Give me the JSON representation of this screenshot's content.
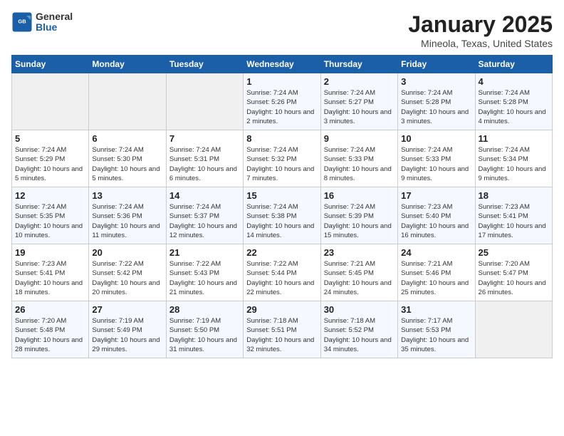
{
  "logo": {
    "general": "General",
    "blue": "Blue"
  },
  "title": "January 2025",
  "subtitle": "Mineola, Texas, United States",
  "weekdays": [
    "Sunday",
    "Monday",
    "Tuesday",
    "Wednesday",
    "Thursday",
    "Friday",
    "Saturday"
  ],
  "weeks": [
    [
      {
        "day": "",
        "sunrise": "",
        "sunset": "",
        "daylight": ""
      },
      {
        "day": "",
        "sunrise": "",
        "sunset": "",
        "daylight": ""
      },
      {
        "day": "",
        "sunrise": "",
        "sunset": "",
        "daylight": ""
      },
      {
        "day": "1",
        "sunrise": "Sunrise: 7:24 AM",
        "sunset": "Sunset: 5:26 PM",
        "daylight": "Daylight: 10 hours and 2 minutes."
      },
      {
        "day": "2",
        "sunrise": "Sunrise: 7:24 AM",
        "sunset": "Sunset: 5:27 PM",
        "daylight": "Daylight: 10 hours and 3 minutes."
      },
      {
        "day": "3",
        "sunrise": "Sunrise: 7:24 AM",
        "sunset": "Sunset: 5:28 PM",
        "daylight": "Daylight: 10 hours and 3 minutes."
      },
      {
        "day": "4",
        "sunrise": "Sunrise: 7:24 AM",
        "sunset": "Sunset: 5:28 PM",
        "daylight": "Daylight: 10 hours and 4 minutes."
      }
    ],
    [
      {
        "day": "5",
        "sunrise": "Sunrise: 7:24 AM",
        "sunset": "Sunset: 5:29 PM",
        "daylight": "Daylight: 10 hours and 5 minutes."
      },
      {
        "day": "6",
        "sunrise": "Sunrise: 7:24 AM",
        "sunset": "Sunset: 5:30 PM",
        "daylight": "Daylight: 10 hours and 5 minutes."
      },
      {
        "day": "7",
        "sunrise": "Sunrise: 7:24 AM",
        "sunset": "Sunset: 5:31 PM",
        "daylight": "Daylight: 10 hours and 6 minutes."
      },
      {
        "day": "8",
        "sunrise": "Sunrise: 7:24 AM",
        "sunset": "Sunset: 5:32 PM",
        "daylight": "Daylight: 10 hours and 7 minutes."
      },
      {
        "day": "9",
        "sunrise": "Sunrise: 7:24 AM",
        "sunset": "Sunset: 5:33 PM",
        "daylight": "Daylight: 10 hours and 8 minutes."
      },
      {
        "day": "10",
        "sunrise": "Sunrise: 7:24 AM",
        "sunset": "Sunset: 5:33 PM",
        "daylight": "Daylight: 10 hours and 9 minutes."
      },
      {
        "day": "11",
        "sunrise": "Sunrise: 7:24 AM",
        "sunset": "Sunset: 5:34 PM",
        "daylight": "Daylight: 10 hours and 9 minutes."
      }
    ],
    [
      {
        "day": "12",
        "sunrise": "Sunrise: 7:24 AM",
        "sunset": "Sunset: 5:35 PM",
        "daylight": "Daylight: 10 hours and 10 minutes."
      },
      {
        "day": "13",
        "sunrise": "Sunrise: 7:24 AM",
        "sunset": "Sunset: 5:36 PM",
        "daylight": "Daylight: 10 hours and 11 minutes."
      },
      {
        "day": "14",
        "sunrise": "Sunrise: 7:24 AM",
        "sunset": "Sunset: 5:37 PM",
        "daylight": "Daylight: 10 hours and 12 minutes."
      },
      {
        "day": "15",
        "sunrise": "Sunrise: 7:24 AM",
        "sunset": "Sunset: 5:38 PM",
        "daylight": "Daylight: 10 hours and 14 minutes."
      },
      {
        "day": "16",
        "sunrise": "Sunrise: 7:24 AM",
        "sunset": "Sunset: 5:39 PM",
        "daylight": "Daylight: 10 hours and 15 minutes."
      },
      {
        "day": "17",
        "sunrise": "Sunrise: 7:23 AM",
        "sunset": "Sunset: 5:40 PM",
        "daylight": "Daylight: 10 hours and 16 minutes."
      },
      {
        "day": "18",
        "sunrise": "Sunrise: 7:23 AM",
        "sunset": "Sunset: 5:41 PM",
        "daylight": "Daylight: 10 hours and 17 minutes."
      }
    ],
    [
      {
        "day": "19",
        "sunrise": "Sunrise: 7:23 AM",
        "sunset": "Sunset: 5:41 PM",
        "daylight": "Daylight: 10 hours and 18 minutes."
      },
      {
        "day": "20",
        "sunrise": "Sunrise: 7:22 AM",
        "sunset": "Sunset: 5:42 PM",
        "daylight": "Daylight: 10 hours and 20 minutes."
      },
      {
        "day": "21",
        "sunrise": "Sunrise: 7:22 AM",
        "sunset": "Sunset: 5:43 PM",
        "daylight": "Daylight: 10 hours and 21 minutes."
      },
      {
        "day": "22",
        "sunrise": "Sunrise: 7:22 AM",
        "sunset": "Sunset: 5:44 PM",
        "daylight": "Daylight: 10 hours and 22 minutes."
      },
      {
        "day": "23",
        "sunrise": "Sunrise: 7:21 AM",
        "sunset": "Sunset: 5:45 PM",
        "daylight": "Daylight: 10 hours and 24 minutes."
      },
      {
        "day": "24",
        "sunrise": "Sunrise: 7:21 AM",
        "sunset": "Sunset: 5:46 PM",
        "daylight": "Daylight: 10 hours and 25 minutes."
      },
      {
        "day": "25",
        "sunrise": "Sunrise: 7:20 AM",
        "sunset": "Sunset: 5:47 PM",
        "daylight": "Daylight: 10 hours and 26 minutes."
      }
    ],
    [
      {
        "day": "26",
        "sunrise": "Sunrise: 7:20 AM",
        "sunset": "Sunset: 5:48 PM",
        "daylight": "Daylight: 10 hours and 28 minutes."
      },
      {
        "day": "27",
        "sunrise": "Sunrise: 7:19 AM",
        "sunset": "Sunset: 5:49 PM",
        "daylight": "Daylight: 10 hours and 29 minutes."
      },
      {
        "day": "28",
        "sunrise": "Sunrise: 7:19 AM",
        "sunset": "Sunset: 5:50 PM",
        "daylight": "Daylight: 10 hours and 31 minutes."
      },
      {
        "day": "29",
        "sunrise": "Sunrise: 7:18 AM",
        "sunset": "Sunset: 5:51 PM",
        "daylight": "Daylight: 10 hours and 32 minutes."
      },
      {
        "day": "30",
        "sunrise": "Sunrise: 7:18 AM",
        "sunset": "Sunset: 5:52 PM",
        "daylight": "Daylight: 10 hours and 34 minutes."
      },
      {
        "day": "31",
        "sunrise": "Sunrise: 7:17 AM",
        "sunset": "Sunset: 5:53 PM",
        "daylight": "Daylight: 10 hours and 35 minutes."
      },
      {
        "day": "",
        "sunrise": "",
        "sunset": "",
        "daylight": ""
      }
    ]
  ]
}
